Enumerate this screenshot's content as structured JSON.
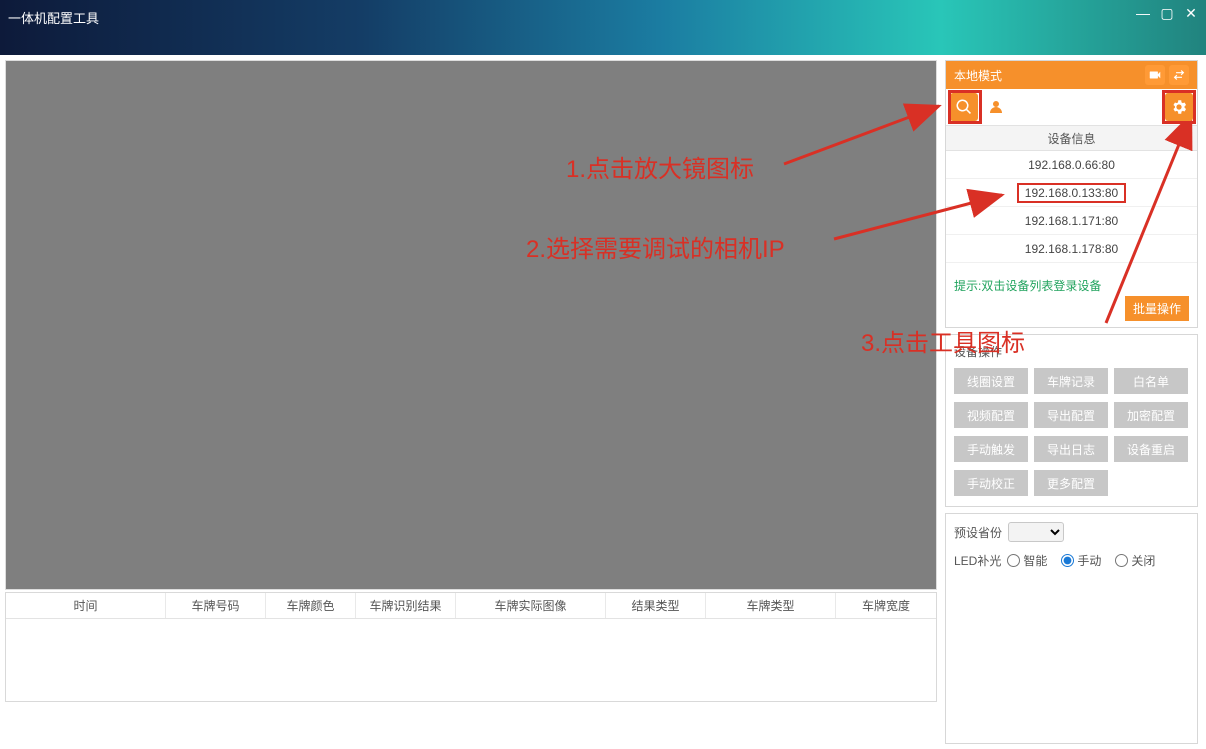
{
  "window": {
    "title": "一体机配置工具"
  },
  "annotations": {
    "step1": "1.点击放大镜图标",
    "step2": "2.选择需要调试的相机IP",
    "step3": "3.点击工具图标"
  },
  "columns": {
    "c0": "时间",
    "c1": "车牌号码",
    "c2": "车牌颜色",
    "c3": "车牌识别结果",
    "c4": "车牌实际图像",
    "c5": "结果类型",
    "c6": "车牌类型",
    "c7": "车牌宽度"
  },
  "side": {
    "mode_title": "本地模式",
    "dev_info_header": "设备信息",
    "devices": [
      {
        "ip": "192.168.0.66:80",
        "selected": false
      },
      {
        "ip": "192.168.0.133:80",
        "selected": true
      },
      {
        "ip": "192.168.1.171:80",
        "selected": false
      },
      {
        "ip": "192.168.1.178:80",
        "selected": false
      }
    ],
    "hint": "提示:双击设备列表登录设备",
    "batch_btn": "批量操作",
    "ops_title": "设备操作",
    "ops": {
      "b0": "线圈设置",
      "b1": "车牌记录",
      "b2": "白名单",
      "b3": "视频配置",
      "b4": "导出配置",
      "b5": "加密配置",
      "b6": "手动触发",
      "b7": "导出日志",
      "b8": "设备重启",
      "b9": "手动校正",
      "b10": "更多配置"
    },
    "pref": {
      "province_label": "预设省份",
      "led_label": "LED补光",
      "r0": "智能",
      "r1": "手动",
      "r2": "关闭",
      "selected_led": "手动"
    }
  }
}
